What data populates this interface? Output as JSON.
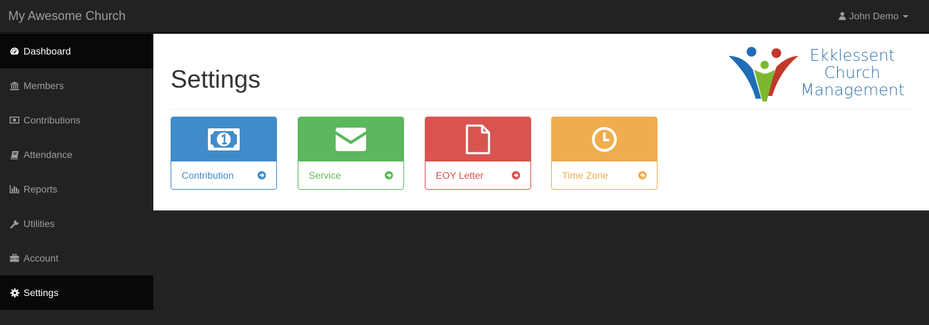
{
  "navbar": {
    "brand": "My Awesome Church",
    "user": {
      "name": "John Demo",
      "icon": "user-icon"
    }
  },
  "sidebar": {
    "items": [
      {
        "label": "Dashboard",
        "icon": "dashboard-icon",
        "active": true
      },
      {
        "label": "Members",
        "icon": "bank-icon",
        "active": false
      },
      {
        "label": "Contributions",
        "icon": "money-icon",
        "active": false
      },
      {
        "label": "Attendance",
        "icon": "book-icon",
        "active": false
      },
      {
        "label": "Reports",
        "icon": "bar-chart-icon",
        "active": false
      },
      {
        "label": "Utilities",
        "icon": "wrench-icon",
        "active": false
      },
      {
        "label": "Account",
        "icon": "briefcase-icon",
        "active": false
      },
      {
        "label": "Settings",
        "icon": "gear-icon",
        "active": true
      }
    ]
  },
  "main": {
    "title": "Settings",
    "logo": {
      "line1": "Ekklessent",
      "line2": "Church",
      "line3": "Management"
    },
    "tiles": [
      {
        "label": "Contribution",
        "icon": "money-icon",
        "color": "#428bca"
      },
      {
        "label": "Service",
        "icon": "envelope-icon",
        "color": "#5cb85c"
      },
      {
        "label": "EOY Letter",
        "icon": "file-icon",
        "color": "#d9534f"
      },
      {
        "label": "Time Zone",
        "icon": "clock-icon",
        "color": "#f0ad4e"
      }
    ]
  }
}
